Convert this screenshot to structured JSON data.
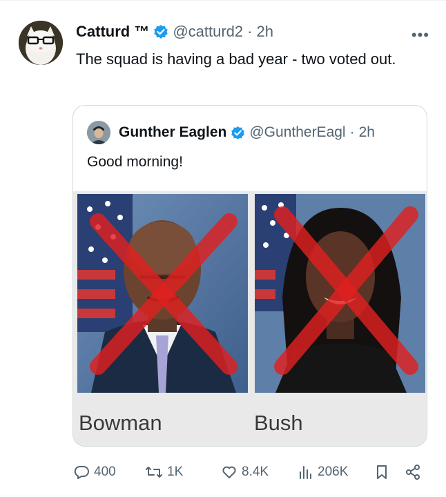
{
  "tweet": {
    "author_name": "Catturd ™",
    "handle": "@catturd2",
    "separator": "·",
    "time": "2h",
    "text": "The squad is having a bad year - two voted out.",
    "more_label": "•••"
  },
  "quoted": {
    "author_name": "Gunther Eaglen",
    "handle": "@GuntherEagl",
    "separator": "·",
    "time": "2h",
    "text": "Good morning!",
    "captions": [
      "Bowman",
      "Bush"
    ]
  },
  "actions": {
    "replies": "400",
    "reposts": "1K",
    "likes": "8.4K",
    "views": "206K"
  },
  "colors": {
    "verified": "#1d9bf0",
    "muted_text": "#536471",
    "cross": "#e02020"
  }
}
